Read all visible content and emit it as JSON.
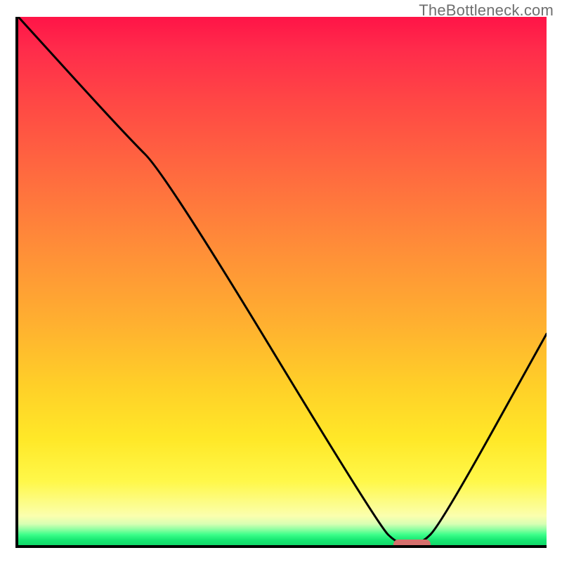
{
  "watermark": "TheBottleneck.com",
  "chart_data": {
    "type": "line",
    "title": "",
    "xlabel": "",
    "ylabel": "",
    "x": [
      0.0,
      0.2,
      0.28,
      0.68,
      0.72,
      0.76,
      0.8,
      1.0
    ],
    "values": [
      100,
      78,
      70,
      4,
      0,
      0,
      4,
      40
    ],
    "ylim": [
      0,
      100
    ],
    "xlim": [
      0,
      1
    ],
    "marker": {
      "x_start": 0.71,
      "x_end": 0.78,
      "y": 0
    },
    "gradient": {
      "stops": [
        {
          "pos": 0.0,
          "color": "#ff1447"
        },
        {
          "pos": 0.3,
          "color": "#ff6b3f"
        },
        {
          "pos": 0.6,
          "color": "#ffb030"
        },
        {
          "pos": 0.85,
          "color": "#fff84a"
        },
        {
          "pos": 0.97,
          "color": "#8fffa2"
        },
        {
          "pos": 1.0,
          "color": "#10d969"
        }
      ]
    }
  }
}
